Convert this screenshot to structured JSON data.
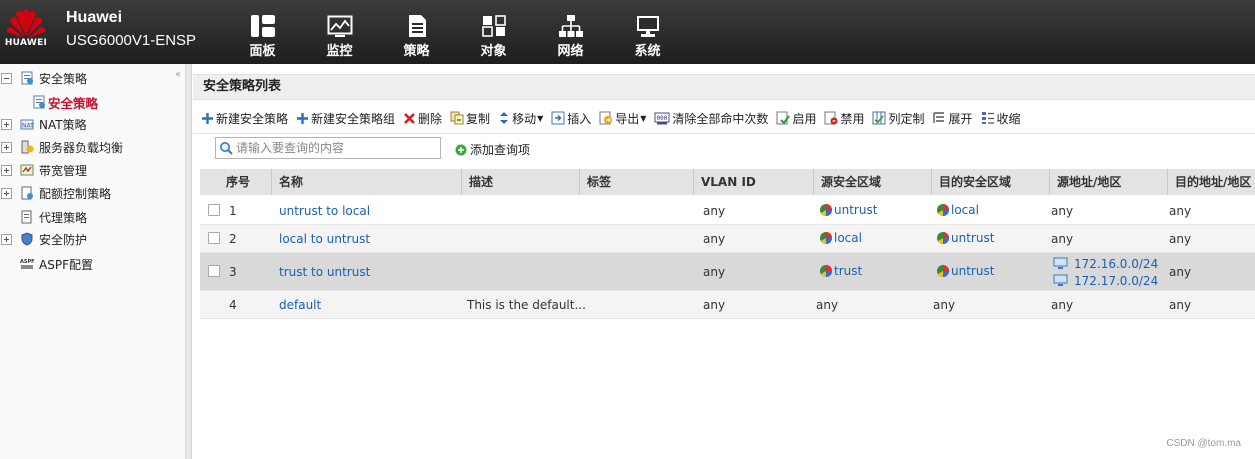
{
  "header": {
    "brand_name": "Huawei",
    "device_name": "USG6000V1-ENSP",
    "logo_text": "HUAWEI",
    "nav": [
      {
        "label": "面板",
        "icon": "dashboard-icon"
      },
      {
        "label": "监控",
        "icon": "monitor-icon"
      },
      {
        "label": "策略",
        "icon": "policy-icon"
      },
      {
        "label": "对象",
        "icon": "object-icon"
      },
      {
        "label": "网络",
        "icon": "network-icon"
      },
      {
        "label": "系统",
        "icon": "system-icon"
      }
    ]
  },
  "sidebar": {
    "items": [
      {
        "label": "安全策略",
        "expanded": true
      },
      {
        "label": "安全策略",
        "selected": true
      },
      {
        "label": "NAT策略"
      },
      {
        "label": "服务器负载均衡"
      },
      {
        "label": "带宽管理"
      },
      {
        "label": "配额控制策略"
      },
      {
        "label": "代理策略"
      },
      {
        "label": "安全防护"
      },
      {
        "label": "ASPF配置"
      }
    ]
  },
  "main": {
    "title": "安全策略列表",
    "toolbar": {
      "new_policy": "新建安全策略",
      "new_policy_group": "新建安全策略组",
      "delete": "删除",
      "copy": "复制",
      "move": "移动",
      "insert": "插入",
      "export": "导出",
      "clear_hits": "清除全部命中次数",
      "enable": "启用",
      "disable": "禁用",
      "columns": "列定制",
      "expand": "展开",
      "collapse": "收缩"
    },
    "search": {
      "placeholder": "请输入要查询的内容",
      "add_query": "添加查询项"
    },
    "table": {
      "headers": [
        "序号",
        "名称",
        "描述",
        "标签",
        "VLAN ID",
        "源安全区域",
        "目的安全区域",
        "源地址/地区",
        "目的地址/地区"
      ],
      "rows": [
        {
          "no": "1",
          "name": "untrust to local",
          "desc": "",
          "vlan": "any",
          "src_zone": "untrust",
          "dst_zone": "local",
          "src_addr": [
            "any"
          ],
          "dst_addr": "any"
        },
        {
          "no": "2",
          "name": "local to untrust",
          "desc": "",
          "vlan": "any",
          "src_zone": "local",
          "dst_zone": "untrust",
          "src_addr": [
            "any"
          ],
          "dst_addr": "any"
        },
        {
          "no": "3",
          "name": "trust to untrust",
          "desc": "",
          "vlan": "any",
          "src_zone": "trust",
          "dst_zone": "untrust",
          "src_addr": [
            "172.16.0.0/24",
            "172.17.0.0/24"
          ],
          "dst_addr": "any"
        },
        {
          "no": "4",
          "name": "default",
          "desc": "This is the default...",
          "vlan": "any",
          "src_zone": "any",
          "dst_zone": "any",
          "src_addr": [
            "any"
          ],
          "dst_addr": "any"
        }
      ]
    }
  },
  "watermark": "CSDN @tom.ma",
  "colors": {
    "header_bg": "#2b2b2b",
    "link": "#1a5fb4",
    "selected_sidebar": "#c8102e",
    "logo_red": "#d7000f"
  }
}
